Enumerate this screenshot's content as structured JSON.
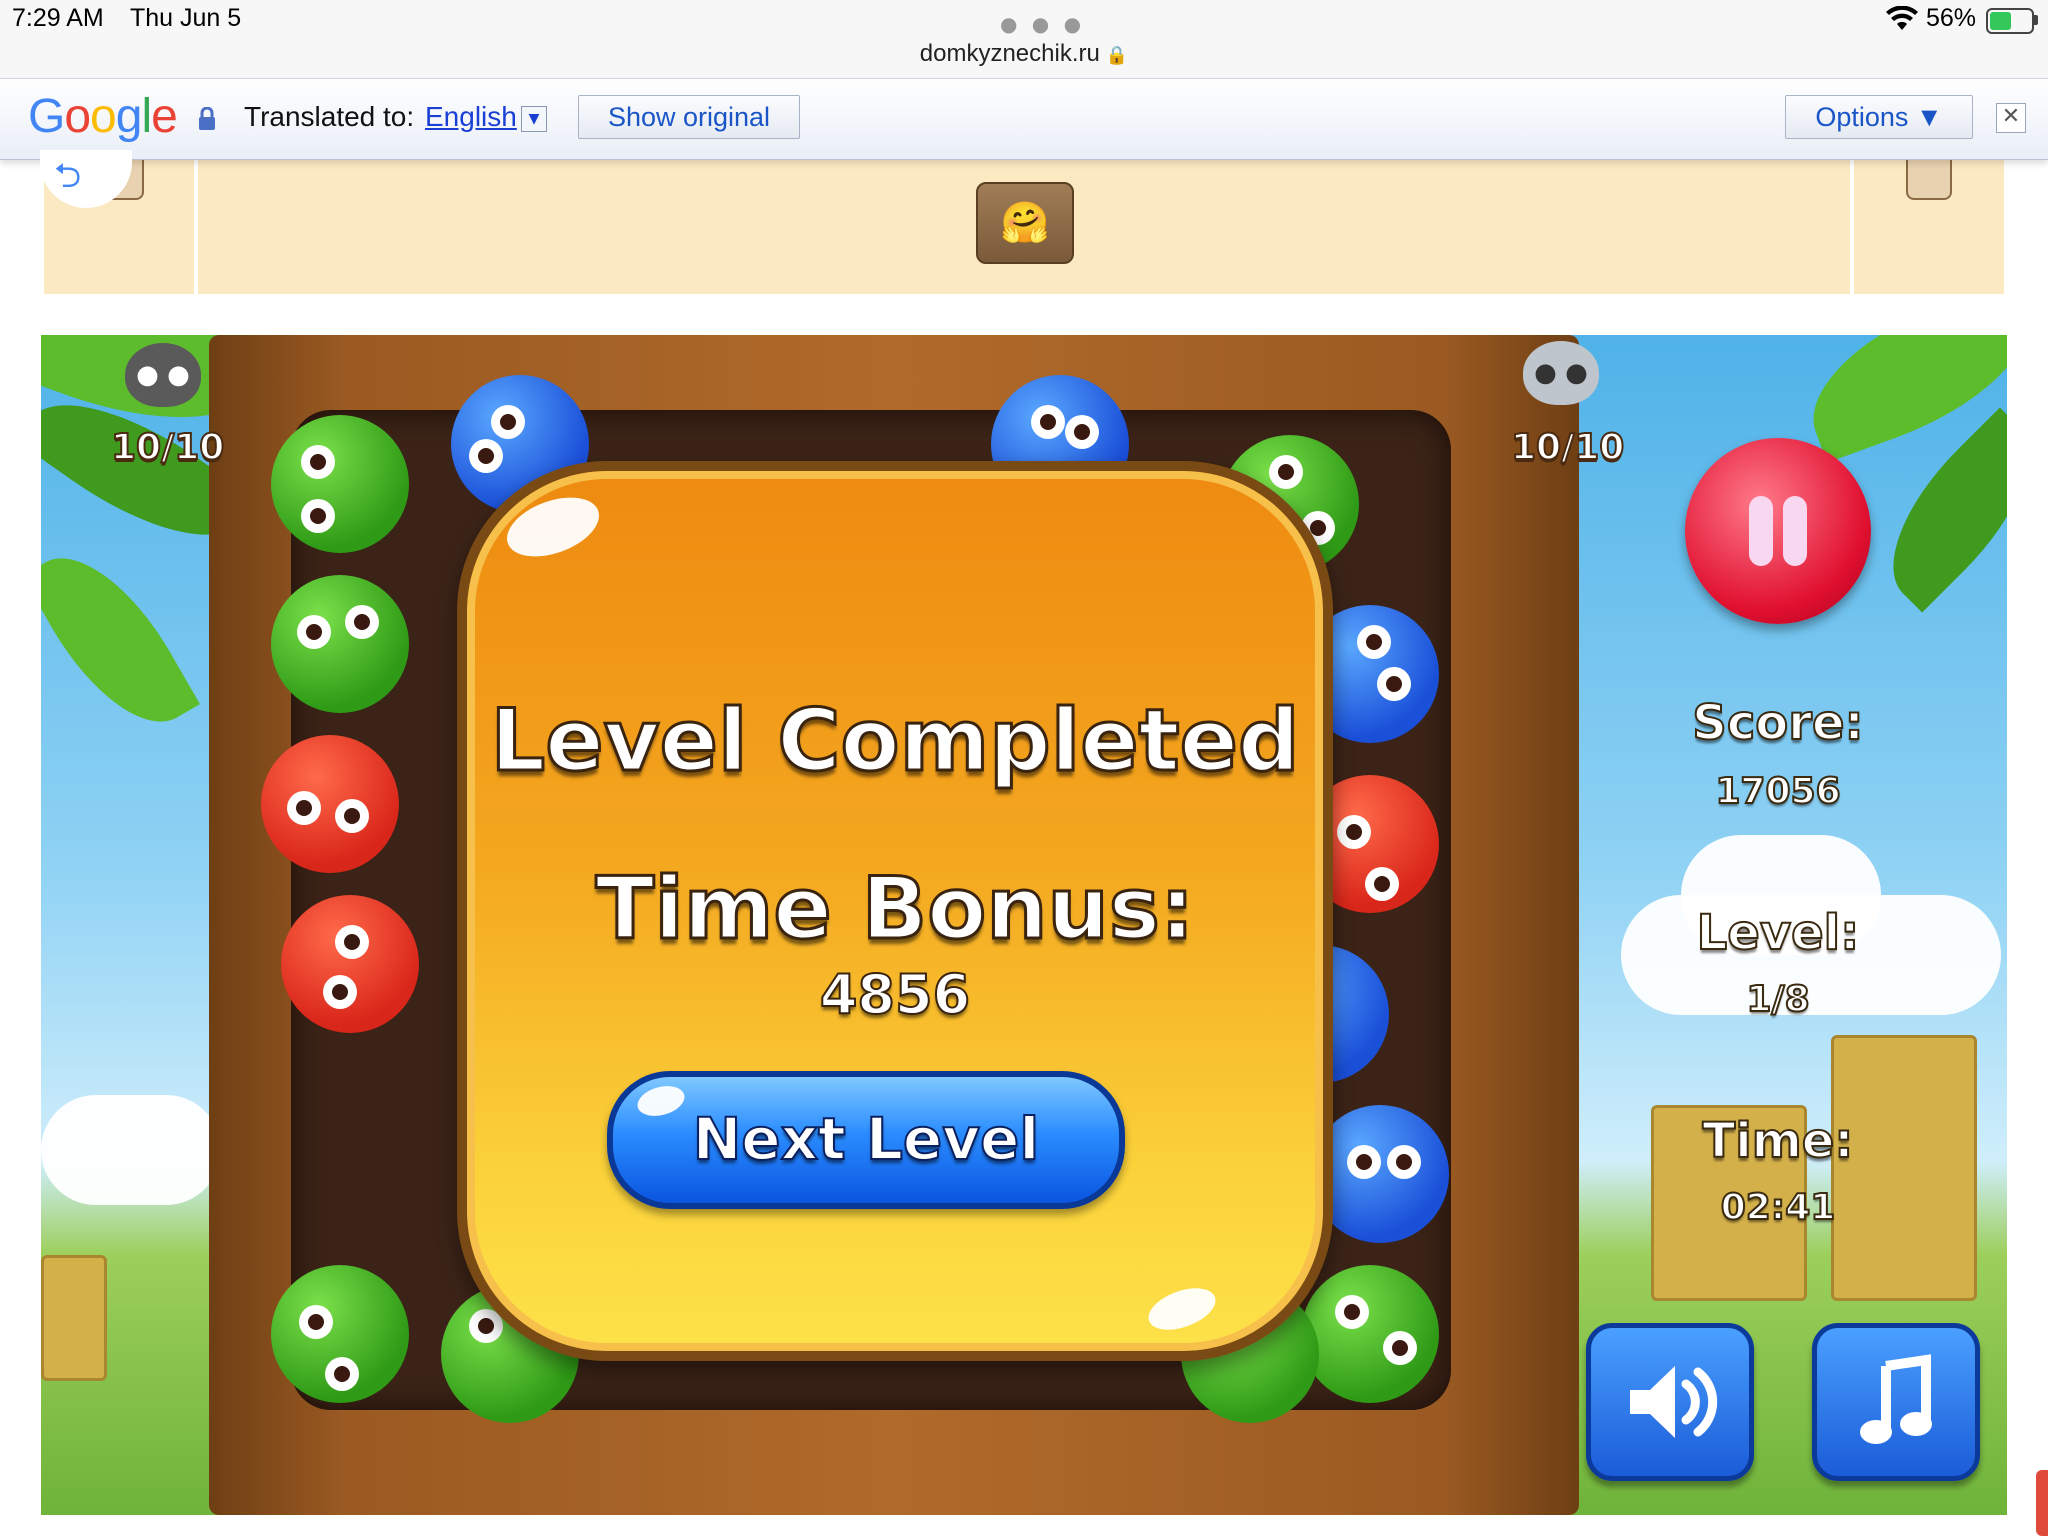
{
  "status_bar": {
    "time": "7:29 AM",
    "date": "Thu Jun 5",
    "url": "domkyznechik.ru",
    "battery_percent": "56%",
    "battery_level": 0.56
  },
  "translate_bar": {
    "logo_letters": [
      "G",
      "o",
      "o",
      "g",
      "l",
      "e"
    ],
    "logo_colors": [
      "#4285f4",
      "#ea4335",
      "#fbbc05",
      "#4285f4",
      "#34a853",
      "#ea4335"
    ],
    "translated_to_label": "Translated to:",
    "language": "English",
    "show_original_label": "Show original",
    "options_label": "Options ▼",
    "close_symbol": "✕"
  },
  "top_strip": {
    "emoji": "🤗"
  },
  "game": {
    "counters": [
      {
        "animal": "hippo",
        "icon": "hippo-icon",
        "text": "10/10"
      },
      {
        "animal": "raccoon",
        "icon": "raccoon-icon",
        "text": "10/10"
      }
    ],
    "hud": {
      "score_label": "Score:",
      "score_value": "17056",
      "level_label": "Level:",
      "level_value": "1/8",
      "time_label": "Time:",
      "time_value": "02:41"
    },
    "buttons": {
      "pause_icon": "pause-icon",
      "sound_icon": "speaker-icon",
      "music_icon": "music-note-icon"
    },
    "dialog": {
      "title": "Level Completed",
      "bonus_label": "Time Bonus:",
      "bonus_value": "4856",
      "next_button": "Next Level"
    },
    "piece_colors": {
      "green": "#2f9a16",
      "blue": "#1a4fd8",
      "red": "#d9261a"
    }
  }
}
